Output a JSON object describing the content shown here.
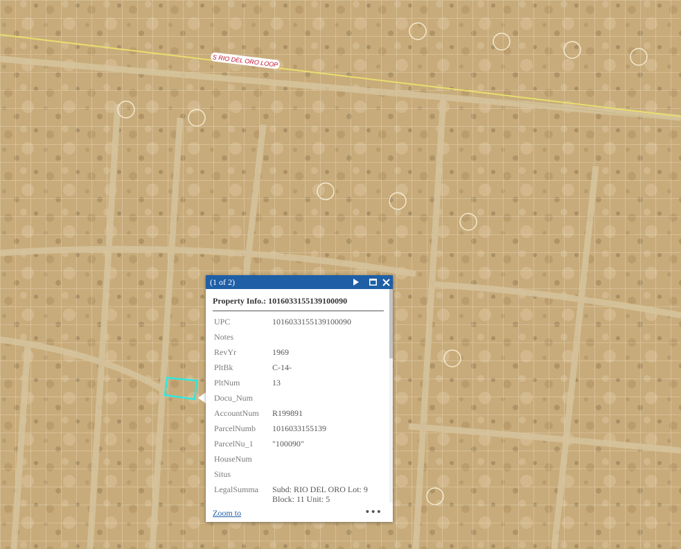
{
  "map": {
    "road_label": "S RIO DEL ORO LOOP",
    "colors": {
      "ground": "#c8ab7a",
      "parcel_lines": "#f7efd9",
      "road": "#e6dd7a",
      "selection": "#2ee8e0"
    }
  },
  "popup": {
    "count": "(1 of 2)",
    "title": "Property Info.: 1016033155139100090",
    "attributes": [
      {
        "key": "UPC",
        "value": "1016033155139100090"
      },
      {
        "key": "Notes",
        "value": ""
      },
      {
        "key": "RevYr",
        "value": "1969"
      },
      {
        "key": "PltBk",
        "value": "C-14-"
      },
      {
        "key": "PltNum",
        "value": "13"
      },
      {
        "key": "Docu_Num",
        "value": ""
      },
      {
        "key": "AccountNum",
        "value": "R199891"
      },
      {
        "key": "ParcelNumb",
        "value": "1016033155139"
      },
      {
        "key": "ParcelNu_1",
        "value": "\"100090\""
      },
      {
        "key": "HouseNum",
        "value": ""
      },
      {
        "key": "Situs",
        "value": ""
      },
      {
        "key": "LegalSumma",
        "value": "Subd: RIO DEL ORO Lot: 9 Block: 11 Unit: 5"
      }
    ],
    "zoom_label": "Zoom to",
    "more_label": "•••",
    "icons": {
      "next": "play-icon",
      "maximize": "maximize-icon",
      "close": "close-icon",
      "more": "ellipsis-icon"
    }
  }
}
